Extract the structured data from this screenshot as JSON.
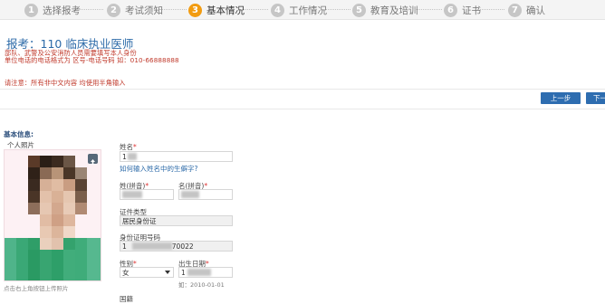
{
  "steps": [
    {
      "num": "1",
      "label": "选择报考"
    },
    {
      "num": "2",
      "label": "考试须知"
    },
    {
      "num": "3",
      "label": "基本情况"
    },
    {
      "num": "4",
      "label": "工作情况"
    },
    {
      "num": "5",
      "label": "教育及培训"
    },
    {
      "num": "6",
      "label": "证书"
    },
    {
      "num": "7",
      "label": "确认"
    }
  ],
  "exam_title": "报考：110 临床执业医师",
  "notices": [
    "部队、武警及公安消防人员需要填写本人身份",
    "单位电话的电话格式为 区号-电话号码 如：010-66888888",
    "请注意：所有非中文内容 均使用半角输入"
  ],
  "buttons": {
    "prev": "上一步",
    "next": "下一"
  },
  "section_title": "基本信息:",
  "photo": {
    "label": "个人照片",
    "hint": "点击右上角按钮上传照片"
  },
  "form": {
    "name": {
      "label": "姓名",
      "value": "1"
    },
    "name_help_link": "如何输入姓名中的生僻字?",
    "surname_pinyin": {
      "label": "姓(拼音)"
    },
    "given_pinyin": {
      "label": "名(拼音)"
    },
    "id_type": {
      "label": "证件类型",
      "value": "居民身份证"
    },
    "id_number": {
      "label": "身份证明号码",
      "prefix": "1",
      "suffix": "70022"
    },
    "gender": {
      "label": "性别",
      "value": "女"
    },
    "birth_date": {
      "label": "出生日期",
      "value": "1",
      "hint": "如：2010-01-01"
    },
    "nationality": {
      "label": "国籍"
    }
  },
  "colors": {
    "accent": "#f29b10",
    "step_inactive": "#c6c6c6",
    "link": "#2c6aa8",
    "notice": "#c0392b",
    "button": "#2e6db0",
    "photo_bg": "#fdf1f4"
  }
}
